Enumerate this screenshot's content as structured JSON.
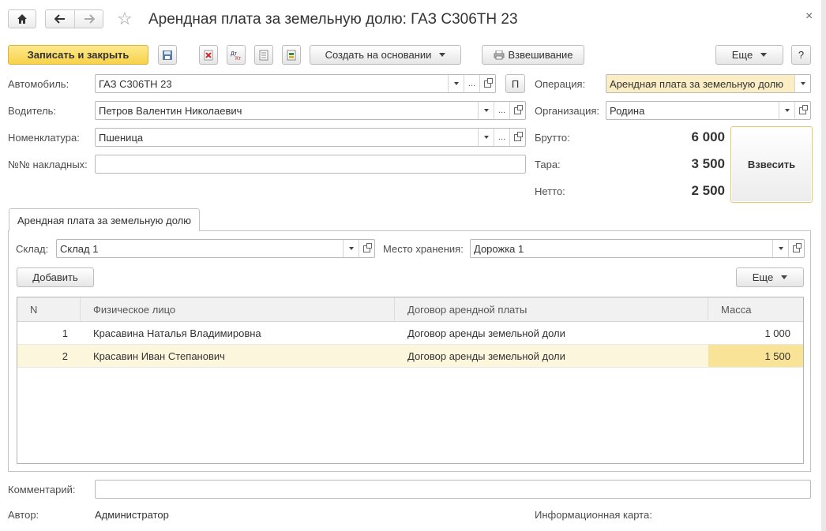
{
  "window": {
    "title": "Арендная плата за земельную долю: ГАЗ С306ТН 23",
    "close": "×",
    "star": "☆"
  },
  "toolbar": {
    "save_close": "Записать и закрыть",
    "create_based": "Создать на основании",
    "weighing": "Взвешивание",
    "more": "Еще",
    "help": "?"
  },
  "form": {
    "car_label": "Автомобиль:",
    "car_value": "ГАЗ С306ТН 23",
    "p_button": "П",
    "driver_label": "Водитель:",
    "driver_value": "Петров Валентин Николаевич",
    "nomen_label": "Номенклатура:",
    "nomen_value": "Пшеница",
    "invoices_label": "№№ накладных:",
    "invoices_value": "",
    "operation_label": "Операция:",
    "operation_value": "Арендная плата за земельную долю",
    "org_label": "Организация:",
    "org_value": "Родина",
    "gross_label": "Брутто:",
    "gross_value": "6 000",
    "tare_label": "Тара:",
    "tare_value": "3 500",
    "net_label": "Нетто:",
    "net_value": "2 500",
    "weigh_button": "Взвесить"
  },
  "tab": {
    "label": "Арендная плата за земельную долю",
    "warehouse_label": "Склад:",
    "warehouse_value": "Склад 1",
    "storage_label": "Место хранения:",
    "storage_value": "Дорожка 1",
    "add_button": "Добавить",
    "more_button": "Еще"
  },
  "table": {
    "headers": {
      "n": "N",
      "person": "Физическое лицо",
      "contract": "Договор арендной платы",
      "mass": "Масса"
    },
    "rows": [
      {
        "n": "1",
        "person": "Красавина Наталья Владимировна",
        "contract": "Договор аренды земельной доли",
        "mass": "1 000"
      },
      {
        "n": "2",
        "person": "Красавин Иван Степанович",
        "contract": "Договор аренды земельной доли",
        "mass": "1 500"
      }
    ]
  },
  "footer": {
    "comment_label": "Комментарий:",
    "comment_value": "",
    "author_label": "Автор:",
    "author_value": "Администратор",
    "info_card_label": "Информационная карта:"
  },
  "colors": {
    "primary_button": "#f7d24a",
    "operation_field": "#fbedc4",
    "selected_row": "#fcf6dc",
    "selected_cell": "#f9e396"
  },
  "icons": [
    "home-icon",
    "back-arrow-icon",
    "forward-arrow-icon",
    "favorite-star-icon",
    "close-icon",
    "save-disk-icon",
    "delete-mark-icon",
    "dt-kt-icon",
    "document-icon",
    "print-icon",
    "dropdown-caret-icon",
    "open-icon"
  ]
}
